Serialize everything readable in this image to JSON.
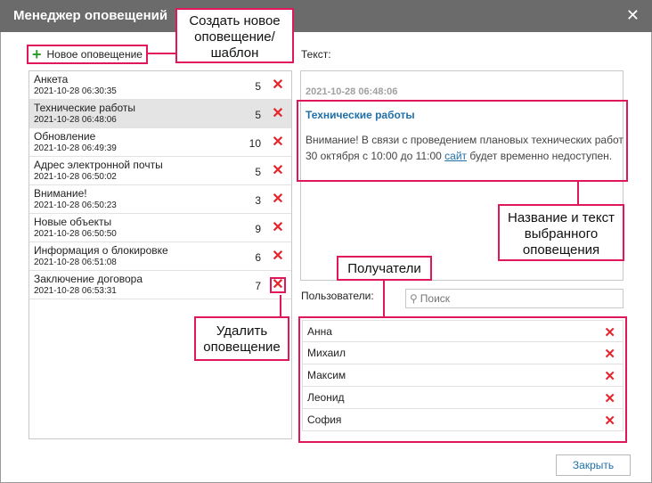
{
  "window": {
    "title": "Менеджер оповещений",
    "close_glyph": "✕"
  },
  "toolbar": {
    "new_label": "Новое оповещение",
    "new_icon": "plus-icon"
  },
  "callouts": {
    "create": "Создать новое оповещение/ шаблон",
    "delete": "Удалить оповещение",
    "message": "Название и текст выбранного оповещения",
    "recipients": "Получатели"
  },
  "notifications": [
    {
      "name": "Анкета",
      "date": "2021-10-28 06:30:35",
      "count": "5"
    },
    {
      "name": "Технические работы",
      "date": "2021-10-28 06:48:06",
      "count": "5"
    },
    {
      "name": "Обновление",
      "date": "2021-10-28 06:49:39",
      "count": "10"
    },
    {
      "name": "Адрес электронной почты",
      "date": "2021-10-28 06:50:02",
      "count": "5"
    },
    {
      "name": "Внимание!",
      "date": "2021-10-28 06:50:23",
      "count": "3"
    },
    {
      "name": "Новые объекты",
      "date": "2021-10-28 06:50:50",
      "count": "9"
    },
    {
      "name": "Информация о блокировке",
      "date": "2021-10-28 06:51:08",
      "count": "6"
    },
    {
      "name": "Заключение договора",
      "date": "2021-10-28 06:53:31",
      "count": "7"
    }
  ],
  "text_panel": {
    "label": "Текст:",
    "date": "2021-10-28 06:48:06",
    "title": "Технические работы",
    "body_before": "Внимание! В связи с проведением плановых технических работ 30 октября с 10:00 до 11:00 ",
    "link": "сайт",
    "body_after": " будет временно недоступен."
  },
  "users_panel": {
    "label": "Пользователи:",
    "search_placeholder": "Поиск",
    "users": [
      "Анна",
      "Михаил",
      "Максим",
      "Леонид",
      "София"
    ]
  },
  "footer": {
    "close_label": "Закрыть"
  },
  "colors": {
    "highlight": "#e0185a",
    "link": "#1f6fa8",
    "delete": "#e8232c",
    "titlebar": "#6b6b6b"
  }
}
